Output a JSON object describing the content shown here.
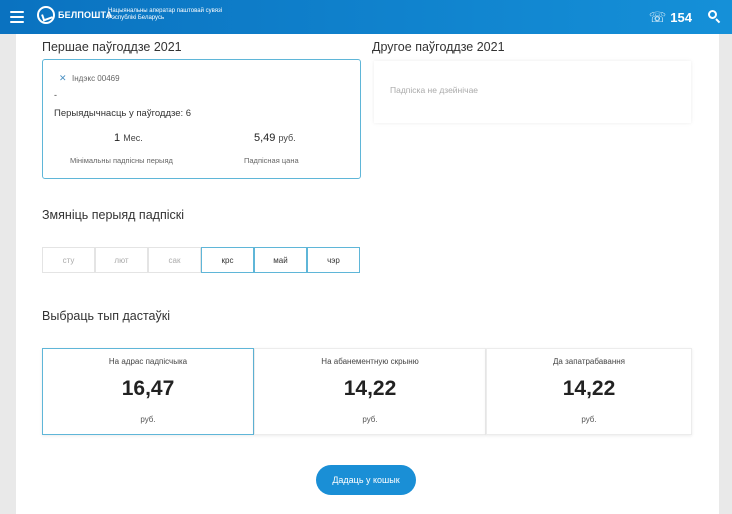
{
  "header": {
    "logo_name": "БЕЛПОШТА",
    "logo_sub_1": "Нацыянальны аператар паштовай сувязі",
    "logo_sub_2": "Рэспублікі Беларусь",
    "phone": "154"
  },
  "first_period": {
    "title": "Першае паўгоддзе 2021",
    "index_label": "Індэкс 00469",
    "dash": "-",
    "frequency": "Перыядычнасць у паўгоддзе: 6",
    "min_period_value": "1",
    "min_period_unit": "Мес.",
    "min_period_caption": "Мінімальны падпісны перыяд",
    "price_value": "5,49",
    "price_unit": "руб.",
    "price_caption": "Падпісная цана"
  },
  "second_period": {
    "title": "Другое паўгоддзе 2021",
    "status": "Падпіска не дзейнічае"
  },
  "change_period": {
    "title": "Змяніць перыяд падпіскі",
    "months": [
      {
        "label": "сту",
        "active": false
      },
      {
        "label": "лют",
        "active": false
      },
      {
        "label": "сак",
        "active": false
      },
      {
        "label": "крс",
        "active": true
      },
      {
        "label": "май",
        "active": true
      },
      {
        "label": "чэр",
        "active": true
      }
    ]
  },
  "delivery": {
    "title": "Выбраць тып дастаўкі",
    "options": [
      {
        "label": "На адрас падпісчыка",
        "amount": "16,47",
        "currency": "руб.",
        "selected": true
      },
      {
        "label": "На абанементную скрыню",
        "amount": "14,22",
        "currency": "руб.",
        "selected": false
      },
      {
        "label": "Да запатрабавання",
        "amount": "14,22",
        "currency": "руб.",
        "selected": false
      }
    ]
  },
  "cart_button": "Дадаць у кошык",
  "colors": {
    "header": "#0a72c0",
    "accent": "#1a8fd6",
    "border_active": "#5fb6d8"
  }
}
